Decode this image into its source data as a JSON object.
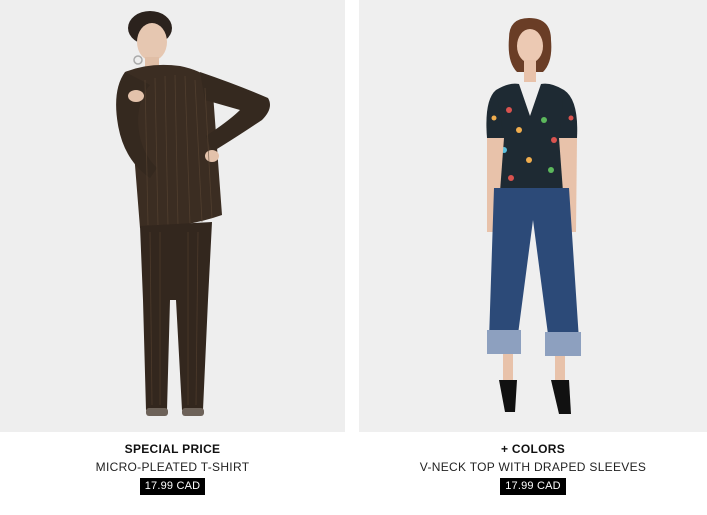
{
  "products": [
    {
      "tag": "SPECIAL PRICE",
      "name": "MICRO-PLEATED T-SHIRT",
      "price": "17.99 CAD"
    },
    {
      "tag": "+ COLORS",
      "name": "V-NECK TOP WITH DRAPED SLEEVES",
      "price": "17.99 CAD"
    }
  ],
  "colors": {
    "image_background": "#eeeeee",
    "price_badge_background": "#000000",
    "price_badge_text": "#ffffff",
    "outfit_left": "#3b2d22",
    "top_right": "#1e2a33",
    "jeans_right": "#2c4a78"
  }
}
